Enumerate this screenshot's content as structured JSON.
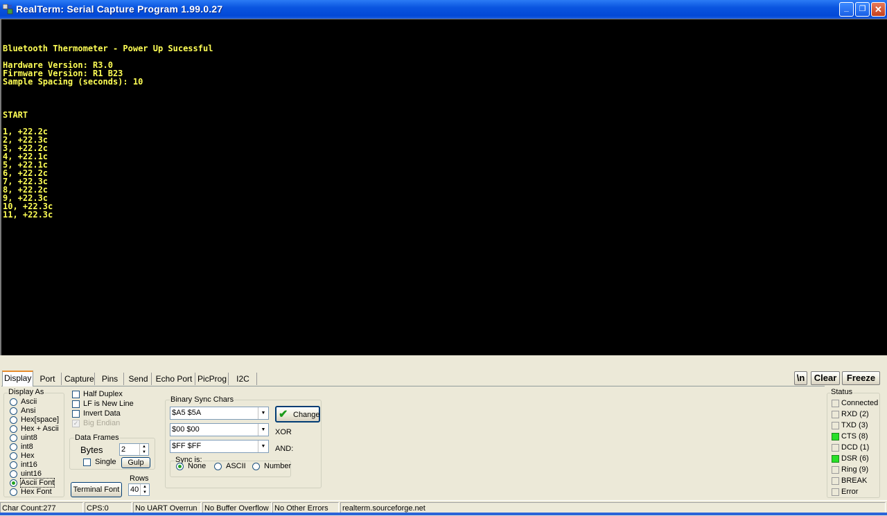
{
  "window": {
    "title": "RealTerm: Serial Capture Program 1.99.0.27",
    "minimize_label": "_",
    "restore_label": "❐",
    "close_label": "✕"
  },
  "terminal": {
    "text_color": "#ffff55",
    "lines": [
      "Bluetooth Thermometer - Power Up Sucessful",
      "Hardware Version: R3.0",
      "Firmware Version: R1 B23",
      "Sample Spacing (seconds): 10",
      "START",
      "1, +22.2c",
      "2, +22.3c",
      "3, +22.2c",
      "4, +22.1c",
      "5, +22.1c",
      "6, +22.2c",
      "7, +22.3c",
      "8, +22.2c",
      "9, +22.3c",
      "10, +22.3c",
      "11, +22.3c"
    ]
  },
  "tabs": [
    "Display",
    "Port",
    "Capture",
    "Pins",
    "Send",
    "Echo Port",
    "PicProg",
    "I2C"
  ],
  "top_buttons": {
    "newline": "\\n",
    "clear": "Clear",
    "freeze": "Freeze"
  },
  "display_as": {
    "label": "Display As",
    "options": [
      "Ascii",
      "Ansi",
      "Hex[space]",
      "Hex + Ascii",
      "uint8",
      "int8",
      "Hex",
      "int16",
      "uint16",
      "Ascii Font",
      "Hex Font"
    ],
    "selected": "Ascii Font"
  },
  "options": {
    "half_duplex": "Half Duplex",
    "lf_new_line": "LF is New Line",
    "invert_data": "Invert Data",
    "big_endian": "Big Endian"
  },
  "data_frames": {
    "label": "Data Frames",
    "bytes_label": "Bytes",
    "bytes_value": "2",
    "single_label": "Single",
    "gulp_label": "Gulp"
  },
  "terminal_font": {
    "button_label": "Terminal Font",
    "rows_label": "Rows",
    "rows_value": "40"
  },
  "binary_sync": {
    "label": "Binary Sync Chars",
    "sync_chars": "$A5 $5A",
    "xor_value": "$00 $00",
    "and_value": "$FF $FF",
    "xor_label": "XOR",
    "and_label": "AND:",
    "change_label": "Change",
    "sync_is_label": "Sync is:",
    "sync_options": [
      "None",
      "ASCII",
      "Number"
    ],
    "sync_selected": "None"
  },
  "status": {
    "label": "Status",
    "on_color": "#28e028",
    "items": [
      {
        "label": "Connected",
        "on": false
      },
      {
        "label": "RXD (2)",
        "on": false
      },
      {
        "label": "TXD (3)",
        "on": false
      },
      {
        "label": "CTS (8)",
        "on": true
      },
      {
        "label": "DCD (1)",
        "on": false
      },
      {
        "label": "DSR (6)",
        "on": true
      },
      {
        "label": "Ring (9)",
        "on": false
      },
      {
        "label": "BREAK",
        "on": false
      },
      {
        "label": "Error",
        "on": false
      }
    ]
  },
  "statusbar": {
    "char_count": "Char Count:277",
    "cps": "CPS:0",
    "uart": "No UART Overrun",
    "buffer": "No Buffer Overflow",
    "errors": "No Other Errors",
    "website": "realterm.sourceforge.net"
  }
}
